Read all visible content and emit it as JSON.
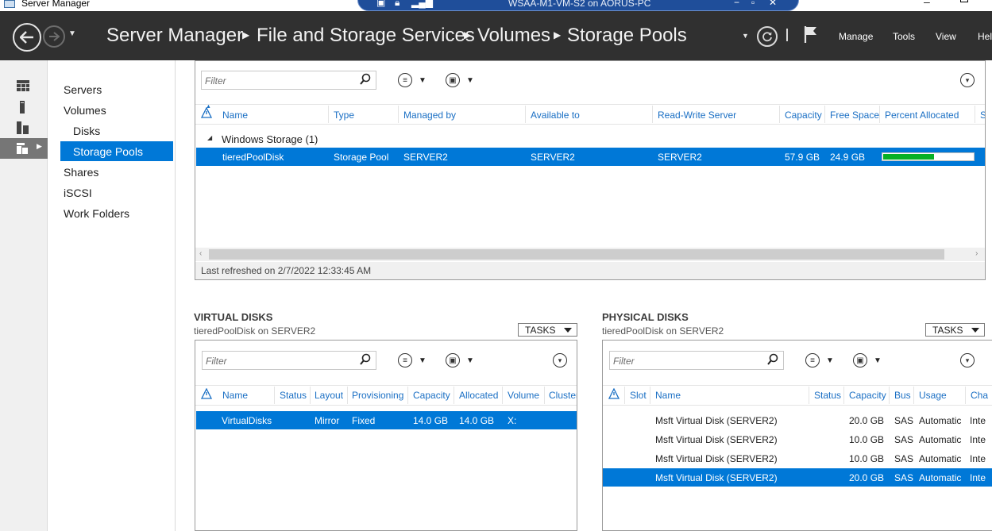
{
  "window": {
    "app_title": "Server Manager",
    "vm_title": "WSAA-M1-VM-S2 on AORUS-PC"
  },
  "header": {
    "breadcrumbs": [
      "Server Manager",
      "File and Storage Services",
      "Volumes",
      "Storage Pools"
    ],
    "menus": [
      "Manage",
      "Tools",
      "View",
      "Help"
    ]
  },
  "rail": {
    "icons": [
      "dashboard-icon",
      "local-server-icon",
      "all-servers-icon",
      "file-storage-icon"
    ]
  },
  "nav": {
    "items": [
      "Servers",
      "Volumes",
      "Disks",
      "Storage Pools",
      "Shares",
      "iSCSI",
      "Work Folders"
    ],
    "selected": "Storage Pools"
  },
  "pools": {
    "filter_placeholder": "Filter",
    "columns": [
      "Name",
      "Type",
      "Managed by",
      "Available to",
      "Read-Write Server",
      "Capacity",
      "Free Space",
      "Percent Allocated",
      "S"
    ],
    "group_label": "Windows Storage (1)",
    "rows": [
      {
        "name": "tieredPoolDisk",
        "type": "Storage Pool",
        "managed_by": "SERVER2",
        "available_to": "SERVER2",
        "rw_server": "SERVER2",
        "capacity": "57.9 GB",
        "free_space": "24.9 GB",
        "percent_allocated": 0.57
      }
    ],
    "status": "Last refreshed on 2/7/2022 12:33:45 AM"
  },
  "virtual_disks": {
    "title": "VIRTUAL DISKS",
    "subtitle": "tieredPoolDisk on SERVER2",
    "tasks_label": "TASKS",
    "filter_placeholder": "Filter",
    "columns": [
      "Name",
      "Status",
      "Layout",
      "Provisioning",
      "Capacity",
      "Allocated",
      "Volume",
      "Cluster"
    ],
    "rows": [
      {
        "name": "VirtualDisks",
        "status": "",
        "layout": "Mirror",
        "provisioning": "Fixed",
        "capacity": "14.0 GB",
        "allocated": "14.0 GB",
        "volume": "X:",
        "cluster": ""
      }
    ]
  },
  "physical_disks": {
    "title": "PHYSICAL DISKS",
    "subtitle": "tieredPoolDisk on SERVER2",
    "tasks_label": "TASKS",
    "filter_placeholder": "Filter",
    "columns": [
      "Slot",
      "Name",
      "Status",
      "Capacity",
      "Bus",
      "Usage",
      "Cha"
    ],
    "rows": [
      {
        "name": "Msft Virtual Disk (SERVER2)",
        "capacity": "20.0 GB",
        "bus": "SAS",
        "usage": "Automatic",
        "chassis": "Inte"
      },
      {
        "name": "Msft Virtual Disk (SERVER2)",
        "capacity": "10.0 GB",
        "bus": "SAS",
        "usage": "Automatic",
        "chassis": "Inte"
      },
      {
        "name": "Msft Virtual Disk (SERVER2)",
        "capacity": "10.0 GB",
        "bus": "SAS",
        "usage": "Automatic",
        "chassis": "Inte"
      },
      {
        "name": "Msft Virtual Disk (SERVER2)",
        "capacity": "20.0 GB",
        "bus": "SAS",
        "usage": "Automatic",
        "chassis": "Inte"
      }
    ],
    "selected_index": 3
  },
  "colors": {
    "header_bg": "#303030",
    "selection": "#0078d7",
    "link_header": "#1a6fc4",
    "progress_fill": "#06b025"
  }
}
